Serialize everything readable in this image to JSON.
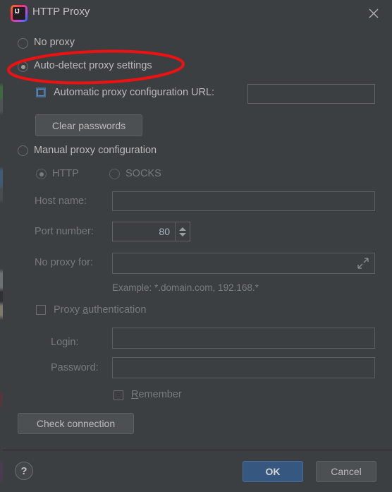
{
  "window": {
    "title": "HTTP Proxy",
    "app_icon": "intellij-idea-logo",
    "app_icon_text": "IJ",
    "close_icon": "close-icon"
  },
  "proxy_mode": {
    "selected": "auto_detect",
    "options": [
      {
        "id": "no_proxy",
        "label": "No proxy",
        "checked": false
      },
      {
        "id": "auto_detect",
        "label": "Auto-detect proxy settings",
        "checked": true
      },
      {
        "id": "manual",
        "label": "Manual proxy configuration",
        "checked": false
      }
    ]
  },
  "auto": {
    "pac_checkbox_label": "Automatic proxy configuration URL:",
    "pac_checked": false,
    "pac_url_value": "",
    "clear_passwords_label": "Clear passwords"
  },
  "manual": {
    "protocol_selected": "HTTP",
    "protocols": [
      {
        "id": "http",
        "label": "HTTP",
        "checked": true
      },
      {
        "id": "socks",
        "label": "SOCKS",
        "checked": false
      }
    ],
    "host_name_label": "Host name:",
    "host_name_value": "",
    "port_number_label": "Port number:",
    "port_number_value": "80",
    "no_proxy_for_label": "No proxy for:",
    "no_proxy_for_value": "",
    "no_proxy_expand_icon": "expand-diagonal-icon",
    "example_text": "Example: *.domain.com, 192.168.*"
  },
  "auth": {
    "proxy_auth_label_pre": "Proxy ",
    "proxy_auth_label_mnemonic": "a",
    "proxy_auth_label_post": "uthentication",
    "proxy_auth_checked": false,
    "login_label": "Login:",
    "login_value": "",
    "password_label": "Password:",
    "password_value": "",
    "remember_label_mnemonic": "R",
    "remember_label_post": "emember",
    "remember_checked": false,
    "check_connection_label": "Check connection"
  },
  "footer": {
    "help_icon": "help-question-icon",
    "help_label": "?",
    "ok_label": "OK",
    "cancel_label": "Cancel"
  },
  "annotation": {
    "shape": "ellipse",
    "color": "#ee1111",
    "target": "Auto-detect proxy settings"
  },
  "colors": {
    "dialog_bg": "#3c3f41",
    "text": "#bbbbbb",
    "accent_blue": "#365880",
    "field_border": "#646464",
    "annotation_red": "#ee1111",
    "value_text": "#a9b7c6"
  }
}
